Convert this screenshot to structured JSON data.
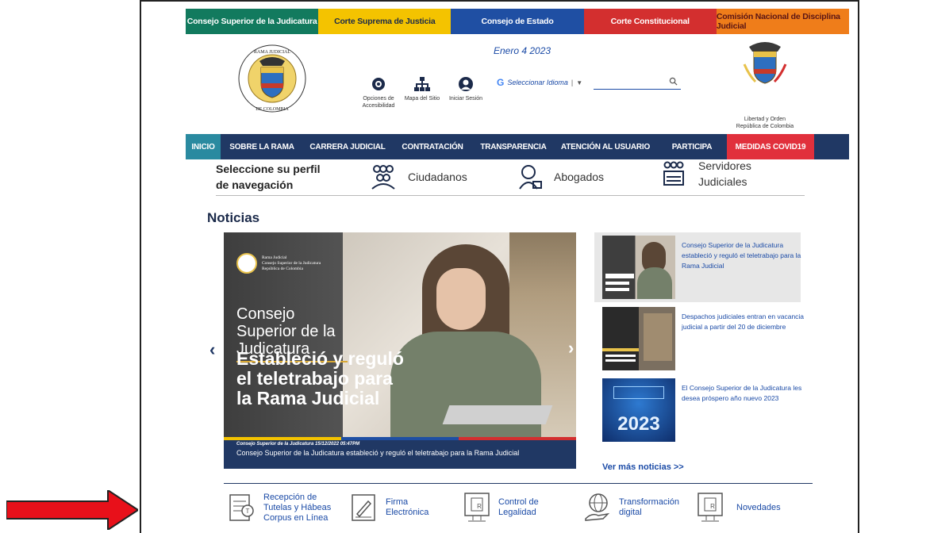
{
  "topbar": [
    {
      "label": "Consejo Superior de la Judicatura",
      "bg": "#127a5e",
      "color": "#ffffff"
    },
    {
      "label": "Corte Suprema de Justicia",
      "bg": "#f4c300",
      "color": "#1b2a4a"
    },
    {
      "label": "Consejo de Estado",
      "bg": "#1f4fa3",
      "color": "#ffffff"
    },
    {
      "label": "Corte Constitucional",
      "bg": "#d32f2f",
      "color": "#ffffff"
    },
    {
      "label": "Comisión Nacional de Disciplina Judicial",
      "bg": "#ef7d1a",
      "color": "#5a1515"
    }
  ],
  "header": {
    "date": "Enero 4 2023",
    "tools": [
      {
        "label": "Opciones de Accesibilidad",
        "icon": "eye-icon"
      },
      {
        "label": "Mapa del Sitio",
        "icon": "sitemap-icon"
      },
      {
        "label": "Iniciar Sesión",
        "icon": "user-icon"
      }
    ],
    "language_placeholder": "Seleccionar Idioma",
    "language_caret": "▼",
    "search_icon": "🔍",
    "shield_caption_1": "Libertad y Orden",
    "shield_caption_2": "República de Colombia"
  },
  "nav": [
    {
      "label": "INICIO",
      "bg": "#2a8aa0"
    },
    {
      "label": "SOBRE LA RAMA",
      "bg": ""
    },
    {
      "label": "CARRERA JUDICIAL",
      "bg": ""
    },
    {
      "label": "CONTRATACIÓN",
      "bg": ""
    },
    {
      "label": "TRANSPARENCIA",
      "bg": ""
    },
    {
      "label": "ATENCIÓN AL USUARIO",
      "bg": ""
    },
    {
      "label": "PARTICIPA",
      "bg": ""
    },
    {
      "label": "MEDIDAS COVID19",
      "bg": "#e1303c"
    }
  ],
  "profile": {
    "title": "Seleccione su perfil de navegación",
    "options": [
      "Ciudadanos",
      "Abogados",
      "Servidores Judiciales"
    ]
  },
  "news": {
    "section_title": "Noticias",
    "slide": {
      "logo_text_1": "Rama Judicial",
      "logo_text_2": "Consejo Superior de la Judicatura",
      "logo_text_3": "República de Colombia",
      "heading_1": "Consejo Superior de la Judicatura",
      "heading_2": "Estableció y reguló el teletrabajo para la Rama Judicial",
      "meta": "Consejo Superior de la Judicatura   15/12/2022 05:47PM",
      "caption": "Consejo Superior de la Judicatura estableció y reguló el teletrabajo para la Rama Judicial"
    },
    "side": [
      {
        "text": "Consejo Superior de la Judicatura estableció y reguló el teletrabajo para la Rama Judicial"
      },
      {
        "text": "Despachos judiciales entran en vacancia judicial a partir del 20 de diciembre"
      },
      {
        "text": "El Consejo Superior de la Judicatura les desea próspero año nuevo 2023"
      }
    ],
    "more": "Ver más noticias >>",
    "prev_glyph": "‹",
    "next_glyph": "›",
    "thumb_2023": "2023"
  },
  "services": [
    {
      "label": "Recepción de Tutelas y Hábeas Corpus en Línea",
      "icon": "tutela-icon"
    },
    {
      "label": "Firma Electrónica",
      "icon": "signature-icon"
    },
    {
      "label": "Control de Legalidad",
      "icon": "legal-doc-icon"
    },
    {
      "label": "Transformación digital",
      "icon": "globe-hand-icon"
    },
    {
      "label": "Novedades",
      "icon": "news-doc-icon"
    }
  ],
  "colors": {
    "navy": "#203864",
    "link_blue": "#1a4aa6",
    "arrow_red": "#e8101a"
  }
}
